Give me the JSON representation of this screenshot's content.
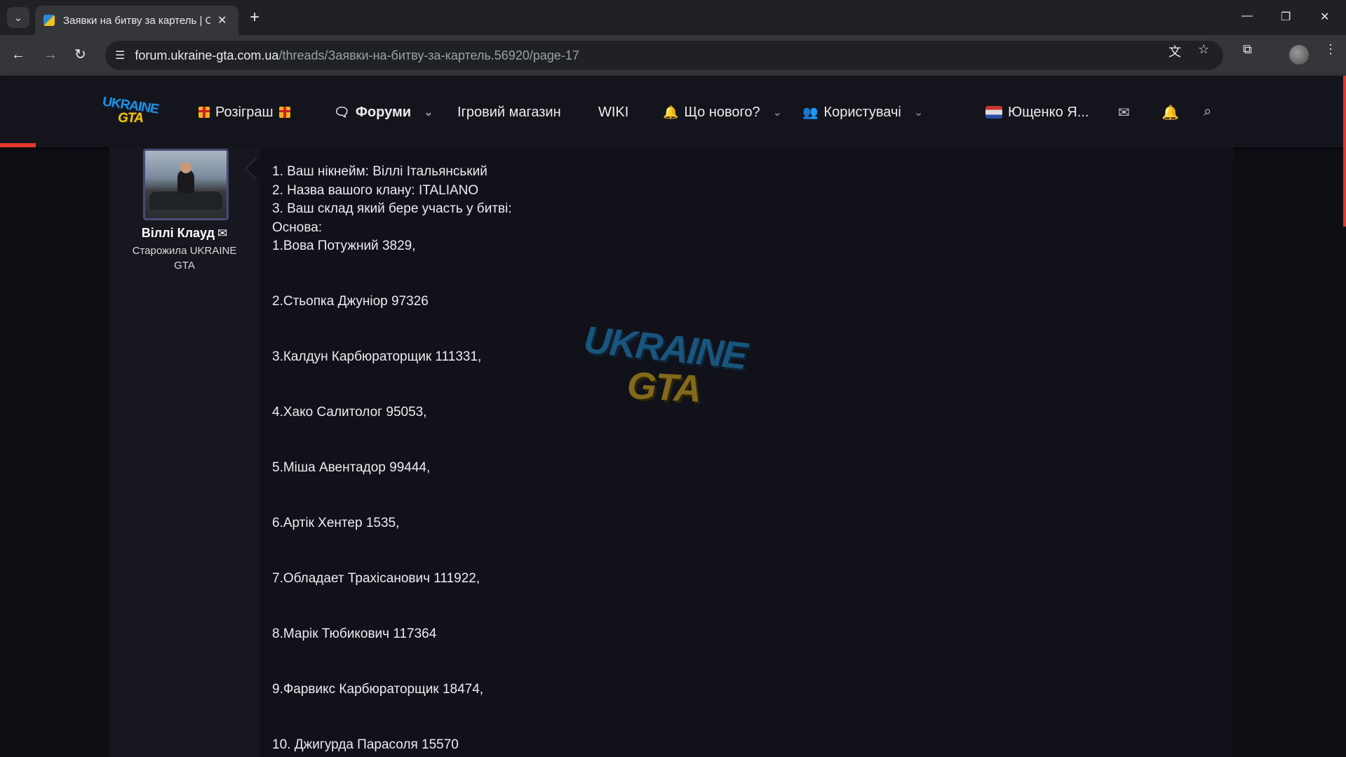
{
  "browser": {
    "tab_title": "Заявки на битву за картель | С",
    "tab_close": "✕",
    "new_tab": "+",
    "url_host": "forum.ukraine-gta.com.ua",
    "url_path": "/threads/Заявки-на-битву-за-картель.56920/page-17",
    "window_controls": [
      "—",
      "❐",
      "✕"
    ]
  },
  "site": {
    "logo_line1": "UKRAINE",
    "logo_line2": "GTA",
    "nav": {
      "giveaway": "Розіграш",
      "forums": "Форуми",
      "shop": "Ігровий магазин",
      "wiki": "WIKI",
      "whats_new": "Що нового?",
      "members": "Користувачі"
    },
    "current_user": "Ющенко Я..."
  },
  "post": {
    "author": "Віллі Клауд",
    "author_title": "Старожила UKRAINE GTA",
    "intro": [
      "1. Ваш нікнейм: Віллі Італьянський",
      "2. Назва вашого клану: ITALIANO",
      "3. Ваш склад який бере участь у битві:",
      "Основа:"
    ],
    "roster": [
      "1.Вова Потужний 3829,",
      "2.Стьопка Джуніор 97326",
      "3.Калдун Карбюраторщик 111331,",
      "4.Хако Салитолог 95053,",
      "5.Міша Авентадор 99444,",
      "6.Артік Хентер 1535,",
      "7.Обладает Трахісанович 111922,",
      "8.Марік Тюбикович 117364",
      "9.Фарвикс Карбюраторщик 18474,",
      "10. Джигурда Парасоля 15570"
    ]
  },
  "colors": {
    "accent": "#e0392e",
    "page_bg": "#0e0e15",
    "header_bg": "#14141c",
    "userpane_bg": "#17171f",
    "logo_blue": "#1e90e0",
    "logo_yellow": "#f2c414"
  },
  "icons": {
    "tab_search": "chevron-down-icon",
    "back": "arrow-left-icon",
    "forward": "arrow-right-icon",
    "reload": "reload-icon",
    "site_info": "tune-icon",
    "translate": "translate-icon",
    "bookmark": "star-icon",
    "extensions": "puzzle-icon",
    "menu": "kebab-icon",
    "forums": "chat-bubble-icon",
    "whats_new": "bell-icon",
    "members": "users-icon",
    "inbox": "envelope-icon",
    "alerts": "bell-icon",
    "search": "search-icon"
  }
}
